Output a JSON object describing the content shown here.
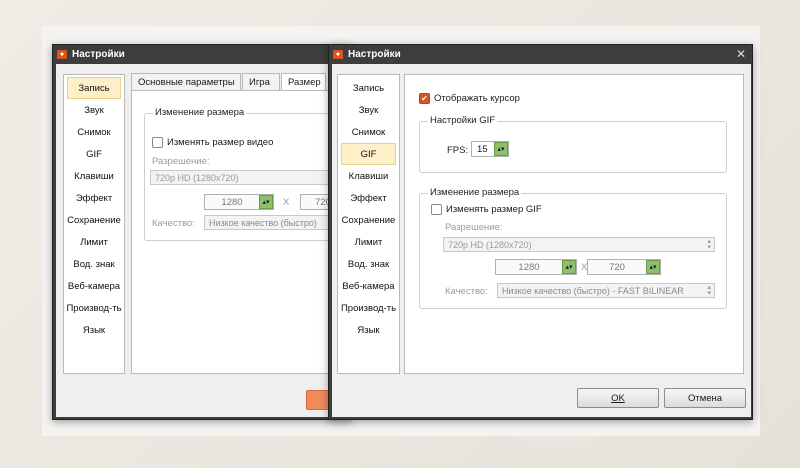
{
  "colors": {
    "accent": "#d9541e",
    "selected_bg": "#fdf0c8",
    "titlebar": "#3d3d3d"
  },
  "back_window": {
    "title": "Настройки",
    "sidebar": [
      {
        "label": "Запись",
        "active": true
      },
      {
        "label": "Звук"
      },
      {
        "label": "Снимок"
      },
      {
        "label": "GIF"
      },
      {
        "label": "Клавиши"
      },
      {
        "label": "Эффект"
      },
      {
        "label": "Сохранение"
      },
      {
        "label": "Лимит"
      },
      {
        "label": "Вод. знак"
      },
      {
        "label": "Веб-камера"
      },
      {
        "label": "Производ-ть"
      },
      {
        "label": "Язык"
      }
    ],
    "tabs": [
      "Основные параметры",
      "Игра",
      "Размер"
    ],
    "resize_group_title": "Изменение размера",
    "resize_video_label": "Изменять размер видео",
    "resolution_label": "Разрешение:",
    "resolution_value": "720p HD (1280x720)",
    "width_value": "1280",
    "x_label": "X",
    "height_value": "720",
    "quality_label": "Качество:",
    "quality_value": "Низкое качество (быстро)"
  },
  "front_window": {
    "title": "Настройки",
    "close_icon": "close-icon",
    "sidebar": [
      {
        "label": "Запись"
      },
      {
        "label": "Звук"
      },
      {
        "label": "Снимок"
      },
      {
        "label": "GIF",
        "active": true
      },
      {
        "label": "Клавиши"
      },
      {
        "label": "Эффект"
      },
      {
        "label": "Сохранение"
      },
      {
        "label": "Лимит"
      },
      {
        "label": "Вод. знак"
      },
      {
        "label": "Веб-камера"
      },
      {
        "label": "Производ-ть"
      },
      {
        "label": "Язык"
      }
    ],
    "show_cursor_label": "Отображать курсор",
    "show_cursor_checked": true,
    "gif_group_title": "Настройки GIF",
    "fps_label": "FPS:",
    "fps_value": "15",
    "resize_group_title": "Изменение размера",
    "resize_gif_label": "Изменять размер GIF",
    "resize_gif_checked": false,
    "resolution_label": "Разрешение:",
    "resolution_value": "720p HD (1280x720)",
    "width_value": "1280",
    "x_label": "X",
    "height_value": "720",
    "quality_label": "Качество:",
    "quality_value": "Низкое качество (быстро) - FAST BILINEAR",
    "ok_label": "OK",
    "cancel_label": "Отмена"
  }
}
